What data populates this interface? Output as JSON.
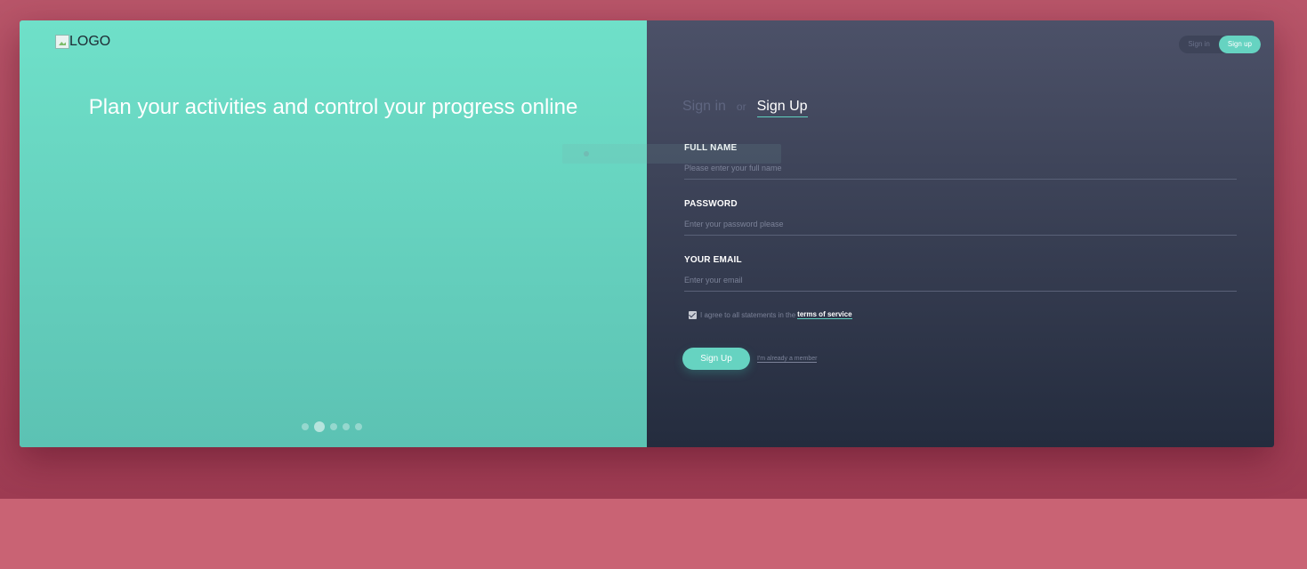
{
  "brand": {
    "logo_alt": "LOGO"
  },
  "left_panel": {
    "headline": "Plan your activities and control your progress online",
    "slider": {
      "count": 5,
      "active_index": 1
    }
  },
  "top_toggle": {
    "signin_label": "Sign in",
    "signup_label": "Sign up"
  },
  "tabs": {
    "signin_label": "Sign in",
    "or_label": "or",
    "signup_label": "Sign Up"
  },
  "form": {
    "full_name": {
      "label": "FULL NAME",
      "placeholder": "Please enter your full name"
    },
    "password": {
      "label": "PASSWORD",
      "placeholder": "Enter your password please"
    },
    "email": {
      "label": "YOUR EMAIL",
      "placeholder": "Enter your email"
    },
    "terms": {
      "text": "I agree to all statements in the",
      "link": "terms of service",
      "checked": true
    },
    "submit_label": "Sign Up",
    "member_link": "I'm already a member"
  },
  "colors": {
    "accent": "#66d3c1",
    "left_top": "#6fe0c9",
    "right_top": "#4c5168",
    "right_bottom": "#242c3e",
    "background": "#c96374"
  }
}
